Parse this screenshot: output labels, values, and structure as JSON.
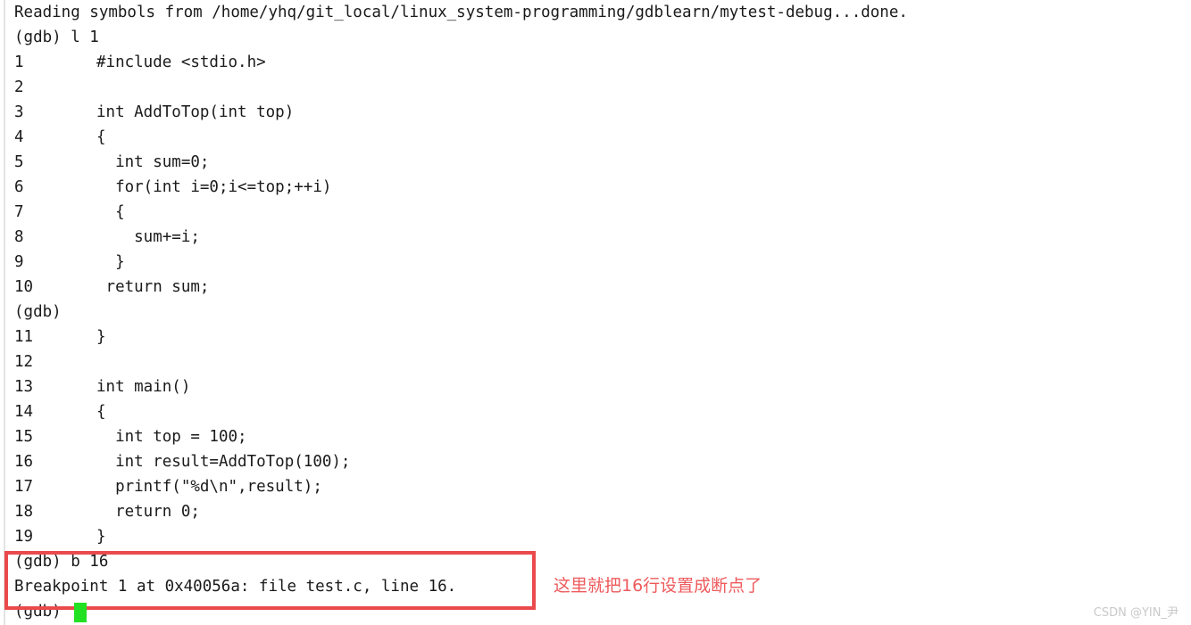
{
  "terminal": {
    "header_line": "Reading symbols from /home/yhq/git_local/linux_system-programming/gdblearn/mytest-debug...done.",
    "prompt_list_command": "(gdb) l 1",
    "prompt_continue": "(gdb)",
    "prompt_break_command": "(gdb) b 16",
    "breakpoint_result": "Breakpoint 1 at 0x40056a: file test.c, line 16.",
    "prompt_final": "(gdb)",
    "code_lines": [
      {
        "num": "1",
        "text": "#include <stdio.h>"
      },
      {
        "num": "2",
        "text": ""
      },
      {
        "num": "3",
        "text": "int AddToTop(int top)"
      },
      {
        "num": "4",
        "text": "{"
      },
      {
        "num": "5",
        "text": "  int sum=0;"
      },
      {
        "num": "6",
        "text": "  for(int i=0;i<=top;++i)"
      },
      {
        "num": "7",
        "text": "  {"
      },
      {
        "num": "8",
        "text": "    sum+=i;"
      },
      {
        "num": "9",
        "text": "  }"
      },
      {
        "num": "10",
        "text": " return sum;"
      }
    ],
    "code_lines_second": [
      {
        "num": "11",
        "text": "}"
      },
      {
        "num": "12",
        "text": ""
      },
      {
        "num": "13",
        "text": "int main()"
      },
      {
        "num": "14",
        "text": "{"
      },
      {
        "num": "15",
        "text": "  int top = 100;"
      },
      {
        "num": "16",
        "text": "  int result=AddToTop(100);"
      },
      {
        "num": "17",
        "text": "  printf(\"%d\\n\",result);"
      },
      {
        "num": "18",
        "text": "  return 0;"
      },
      {
        "num": "19",
        "text": "}"
      }
    ]
  },
  "annotation": {
    "note_text": "这里就把16行设置成断点了",
    "box_color": "#ea4a4c",
    "note_color": "#ee5a5c"
  },
  "cursor": {
    "color": "#22e022"
  },
  "watermark": {
    "text": "CSDN @YIN_尹"
  }
}
